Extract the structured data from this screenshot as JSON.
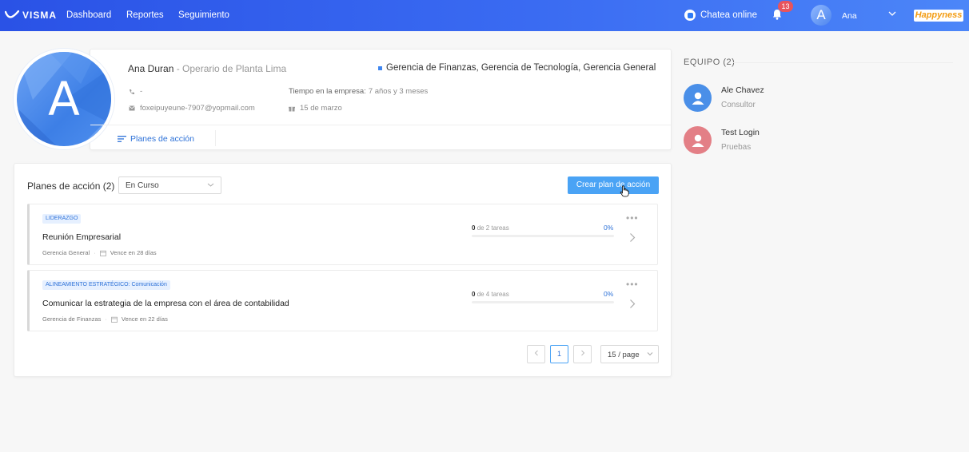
{
  "header": {
    "logo": "VISMA",
    "nav": [
      "Dashboard",
      "Reportes",
      "Seguimiento"
    ],
    "chat_label": "Chatea online",
    "notifications_count": "13",
    "avatar_initial": "A",
    "user_name": "Ana",
    "brand": "Happyness",
    "colors": {
      "bar_start": "#2a52e6",
      "bar_end": "#4c86f8",
      "badge": "#e8545d",
      "brand": "#f39c12"
    }
  },
  "profile": {
    "initial": "A",
    "name": "Ana Duran",
    "separator": " - ",
    "role": "Operario de Planta Lima",
    "departments": "Gerencia de Finanzas, Gerencia de Tecnología, Gerencia General",
    "phone": "-",
    "email": "foxeipuyeune-7907@yopmail.com",
    "tenure_label": "Tiempo en la empresa:",
    "tenure_value": "7 años y 3 meses",
    "birthday": "15 de marzo",
    "tab_label": "Planes de acción"
  },
  "team": {
    "title": "EQUIPO (2)",
    "members": [
      {
        "name": "Ale Chavez",
        "role": "Consultor",
        "color": "#4a8fe8"
      },
      {
        "name": "Test Login",
        "role": "Pruebas",
        "color": "#e37f86"
      }
    ]
  },
  "plans": {
    "title": "Planes de acción (2)",
    "filter_value": "En Curso",
    "create_label": "Crear plan de acción",
    "items": [
      {
        "tag": "LIDERAZGO",
        "name": "Reunión Empresarial",
        "area": "Gerencia General",
        "due": "Vence en 28 días",
        "done": "0",
        "tasks_text": "de 2 tareas",
        "percent": "0%",
        "progress": 0
      },
      {
        "tag": "ALINEAMIENTO ESTRATÉGICO: Comunicación",
        "name": "Comunicar la estrategia de la empresa con el área de contabilidad",
        "area": "Gerencia de Finanzas",
        "due": "Vence en 22 días",
        "done": "0",
        "tasks_text": "de 4 tareas",
        "percent": "0%",
        "progress": 0
      }
    ]
  },
  "pagination": {
    "current_page": "1",
    "page_size": "15 / page"
  }
}
